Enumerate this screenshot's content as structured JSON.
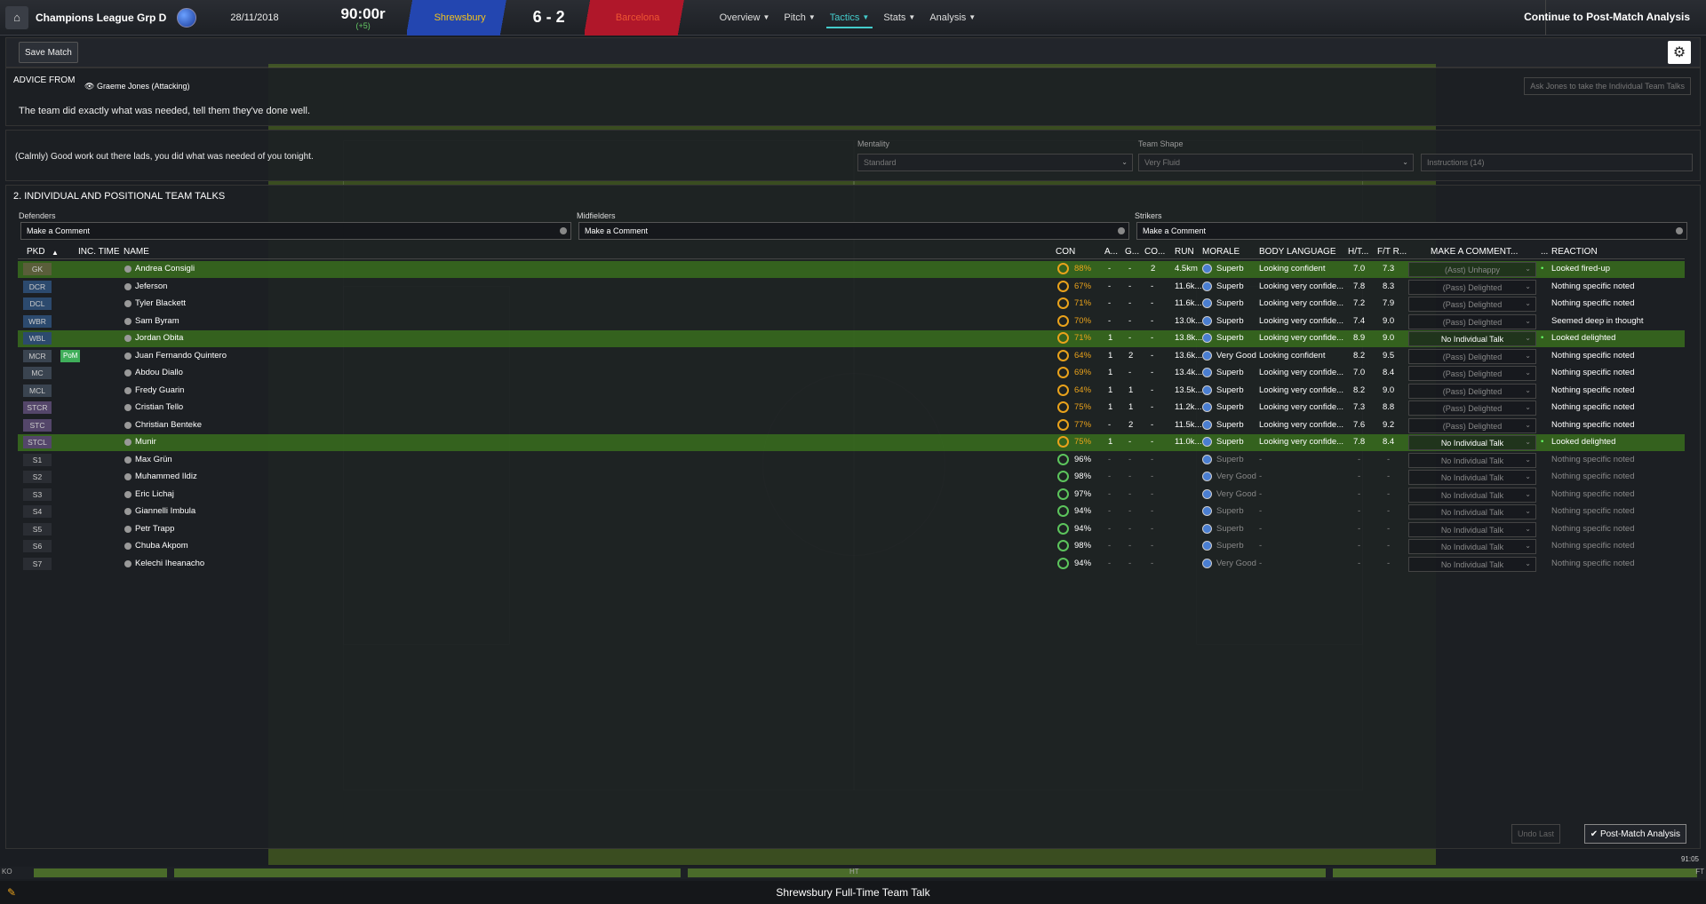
{
  "header": {
    "competition": "Champions League Grp D",
    "date": "28/11/2018",
    "clock": "90:00r",
    "stoppage": "(+5)",
    "home_team": "Shrewsbury",
    "score": "6 - 2",
    "away_team": "Barcelona",
    "continue_label": "Continue to Post-Match Analysis"
  },
  "menu": [
    {
      "label": "Overview"
    },
    {
      "label": "Pitch"
    },
    {
      "label": "Tactics"
    },
    {
      "label": "Stats"
    },
    {
      "label": "Analysis"
    }
  ],
  "toolbar": {
    "save_label": "Save Match"
  },
  "advice": {
    "title": "ADVICE FROM",
    "coach": "Graeme Jones (Attacking)",
    "text": "The team did exactly what was needed, tell them they've done well.",
    "ask_label": "Ask Jones to take the Individual Team Talks"
  },
  "shout": {
    "text": "(Calmly) Good work out there lads, you did what was needed of you tonight.",
    "mentality_label": "Mentality",
    "mentality_value": "Standard",
    "shape_label": "Team Shape",
    "shape_value": "Very Fluid",
    "instructions": "Instructions (14)"
  },
  "individual": {
    "title": "2. INDIVIDUAL AND POSITIONAL TEAM TALKS",
    "defenders_label": "Defenders",
    "midfielders_label": "Midfielders",
    "strikers_label": "Strikers",
    "comment_placeholder": "Make a Comment"
  },
  "columns": {
    "pkd": "PKD",
    "inc": "INC. TIME",
    "name": "NAME",
    "con": "CON",
    "a": "A...",
    "g": "G...",
    "co": "CO...",
    "run": "RUN",
    "morale": "MORALE",
    "body": "BODY LANGUAGE",
    "ht": "H/T...",
    "ft": "F/T R...",
    "comment": "MAKE A COMMENT...",
    "more": "...",
    "reaction": "REACTION"
  },
  "players": [
    {
      "pos": "GK",
      "name": "Andrea Consigli",
      "con": "88%",
      "a": "-",
      "g": "-",
      "co": "2",
      "run": "4.5km",
      "morale": "Superb",
      "body": "Looking confident",
      "ht": "7.0",
      "ft": "7.3",
      "comment": "(Asst) Unhappy",
      "reaction": "Looked fired-up"
    },
    {
      "pos": "DCR",
      "name": "Jeferson",
      "con": "67%",
      "a": "-",
      "g": "-",
      "co": "-",
      "run": "11.6k...",
      "morale": "Superb",
      "body": "Looking very confide...",
      "ht": "7.8",
      "ft": "8.3",
      "comment": "(Pass) Delighted",
      "reaction": "Nothing specific noted"
    },
    {
      "pos": "DCL",
      "name": "Tyler Blackett",
      "con": "71%",
      "a": "-",
      "g": "-",
      "co": "-",
      "run": "11.6k...",
      "morale": "Superb",
      "body": "Looking very confide...",
      "ht": "7.2",
      "ft": "7.9",
      "comment": "(Pass) Delighted",
      "reaction": "Nothing specific noted"
    },
    {
      "pos": "WBR",
      "name": "Sam Byram",
      "con": "70%",
      "a": "-",
      "g": "-",
      "co": "-",
      "run": "13.0k...",
      "morale": "Superb",
      "body": "Looking very confide...",
      "ht": "7.4",
      "ft": "9.0",
      "comment": "(Pass) Delighted",
      "reaction": "Seemed deep in thought"
    },
    {
      "pos": "WBL",
      "name": "Jordan Obita",
      "con": "71%",
      "a": "1",
      "g": "-",
      "co": "-",
      "run": "13.8k...",
      "morale": "Superb",
      "body": "Looking very confide...",
      "ht": "8.9",
      "ft": "9.0",
      "comment": "No Individual Talk",
      "reaction": "Looked delighted"
    },
    {
      "pos": "MCR",
      "pom": "PoM",
      "name": "Juan Fernando Quintero",
      "con": "64%",
      "a": "1",
      "g": "2",
      "co": "-",
      "run": "13.6k...",
      "morale": "Very Good",
      "body": "Looking confident",
      "ht": "8.2",
      "ft": "9.5",
      "comment": "(Pass) Delighted",
      "reaction": "Nothing specific noted"
    },
    {
      "pos": "MC",
      "name": "Abdou Diallo",
      "con": "69%",
      "a": "1",
      "g": "-",
      "co": "-",
      "run": "13.4k...",
      "morale": "Superb",
      "body": "Looking very confide...",
      "ht": "7.0",
      "ft": "8.4",
      "comment": "(Pass) Delighted",
      "reaction": "Nothing specific noted"
    },
    {
      "pos": "MCL",
      "name": "Fredy Guarin",
      "con": "64%",
      "a": "1",
      "g": "1",
      "co": "-",
      "run": "13.5k...",
      "morale": "Superb",
      "body": "Looking very confide...",
      "ht": "8.2",
      "ft": "9.0",
      "comment": "(Pass) Delighted",
      "reaction": "Nothing specific noted"
    },
    {
      "pos": "STCR",
      "name": "Cristian Tello",
      "con": "75%",
      "a": "1",
      "g": "1",
      "co": "-",
      "run": "11.2k...",
      "morale": "Superb",
      "body": "Looking very confide...",
      "ht": "7.3",
      "ft": "8.8",
      "comment": "(Pass) Delighted",
      "reaction": "Nothing specific noted"
    },
    {
      "pos": "STC",
      "name": "Christian Benteke",
      "con": "77%",
      "a": "-",
      "g": "2",
      "co": "-",
      "run": "11.5k...",
      "morale": "Superb",
      "body": "Looking very confide...",
      "ht": "7.6",
      "ft": "9.2",
      "comment": "(Pass) Delighted",
      "reaction": "Nothing specific noted"
    },
    {
      "pos": "STCL",
      "name": "Munir",
      "con": "75%",
      "a": "1",
      "g": "-",
      "co": "-",
      "run": "11.0k...",
      "morale": "Superb",
      "body": "Looking very confide...",
      "ht": "7.8",
      "ft": "8.4",
      "comment": "No Individual Talk",
      "reaction": "Looked delighted"
    },
    {
      "pos": "S1",
      "name": "Max Grün",
      "con": "96%",
      "a": "-",
      "g": "-",
      "co": "-",
      "run": "",
      "morale": "Superb",
      "body": "-",
      "ht": "-",
      "ft": "-",
      "comment": "No Individual Talk",
      "reaction": "Nothing specific noted"
    },
    {
      "pos": "S2",
      "name": "Muhammed Ildiz",
      "con": "98%",
      "a": "-",
      "g": "-",
      "co": "-",
      "run": "",
      "morale": "Very Good",
      "body": "-",
      "ht": "-",
      "ft": "-",
      "comment": "No Individual Talk",
      "reaction": "Nothing specific noted"
    },
    {
      "pos": "S3",
      "name": "Eric Lichaj",
      "con": "97%",
      "a": "-",
      "g": "-",
      "co": "-",
      "run": "",
      "morale": "Very Good",
      "body": "-",
      "ht": "-",
      "ft": "-",
      "comment": "No Individual Talk",
      "reaction": "Nothing specific noted"
    },
    {
      "pos": "S4",
      "name": "Giannelli Imbula",
      "con": "94%",
      "a": "-",
      "g": "-",
      "co": "-",
      "run": "",
      "morale": "Superb",
      "body": "-",
      "ht": "-",
      "ft": "-",
      "comment": "No Individual Talk",
      "reaction": "Nothing specific noted"
    },
    {
      "pos": "S5",
      "name": "Petr Trapp",
      "con": "94%",
      "a": "-",
      "g": "-",
      "co": "-",
      "run": "",
      "morale": "Superb",
      "body": "-",
      "ht": "-",
      "ft": "-",
      "comment": "No Individual Talk",
      "reaction": "Nothing specific noted"
    },
    {
      "pos": "S6",
      "name": "Chuba Akpom",
      "con": "98%",
      "a": "-",
      "g": "-",
      "co": "-",
      "run": "",
      "morale": "Superb",
      "body": "-",
      "ht": "-",
      "ft": "-",
      "comment": "No Individual Talk",
      "reaction": "Nothing specific noted"
    },
    {
      "pos": "S7",
      "name": "Kelechi Iheanacho",
      "con": "94%",
      "a": "-",
      "g": "-",
      "co": "-",
      "run": "",
      "morale": "Very Good",
      "body": "-",
      "ht": "-",
      "ft": "-",
      "comment": "No Individual Talk",
      "reaction": "Nothing specific noted"
    }
  ],
  "footer": {
    "undo_label": "Undo Last",
    "pma_label": "Post-Match Analysis",
    "bottom_title": "Shrewsbury Full-Time Team Talk",
    "clock_small": "91:05",
    "tl_start": "KO",
    "tl_ht": "HT",
    "tl_end": "FT"
  },
  "colors": {
    "home": "#2346b0",
    "away": "#b0172a",
    "accent": "#44cccc",
    "highlight": "#3c781e"
  }
}
